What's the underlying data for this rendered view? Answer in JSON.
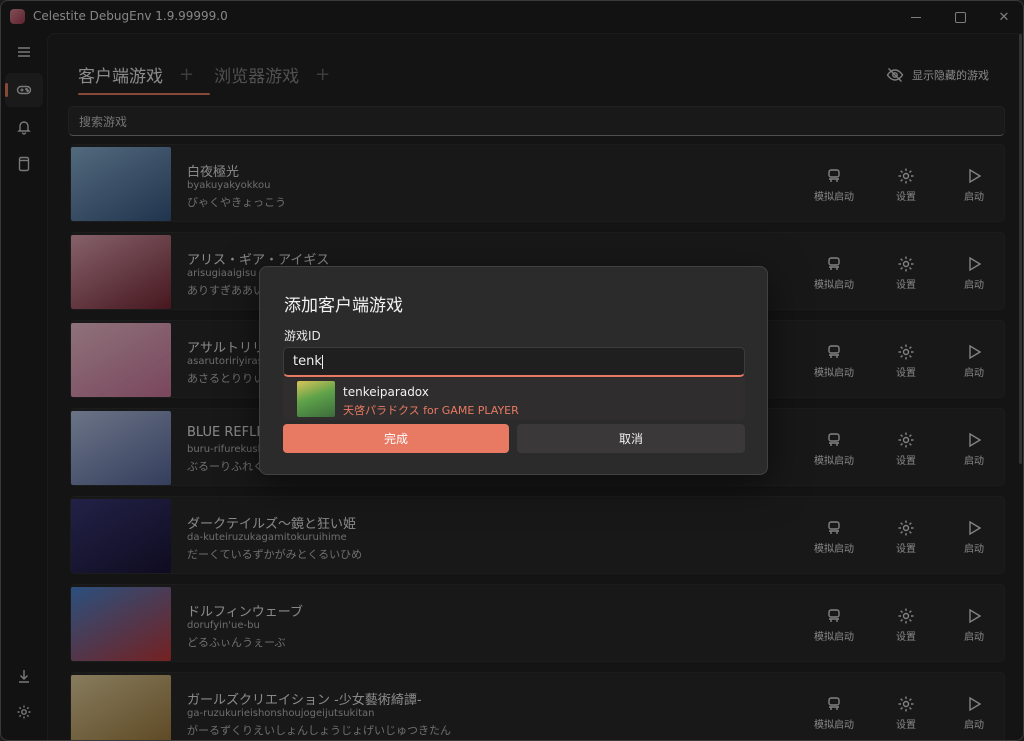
{
  "window": {
    "title": "Celestite DebugEnv 1.9.99999.0"
  },
  "tabs": [
    {
      "label": "客户端游戏",
      "plus": "+"
    },
    {
      "label": "浏览器游戏",
      "plus": "+"
    }
  ],
  "show_hidden": "显示隐藏的游戏",
  "search": {
    "placeholder": "搜索游戏"
  },
  "actions": {
    "simulate": "模拟启动",
    "settings": "设置",
    "launch": "启动"
  },
  "games": [
    {
      "title": "白夜極光",
      "romaji": "byakuyakyokkou",
      "kana": "びゃくやきょっこう",
      "cover_colors": [
        "#8fb6d8",
        "#3a5a86"
      ]
    },
    {
      "title": "アリス・ギア・アイギス",
      "romaji": "arisugiaaigisu",
      "kana": "ありすぎああいぎす",
      "cover_colors": [
        "#e7a8b8",
        "#7a2836"
      ]
    },
    {
      "title": "アサルトリリィ",
      "romaji": "asarutoririyirasuto",
      "kana": "あさるとりりぃらすと",
      "cover_colors": [
        "#f5c4d3",
        "#d27aa0"
      ]
    },
    {
      "title": "BLUE REFLECTION SUN",
      "romaji": "buru-rifurekushonsan",
      "kana": "ぶるーりふれくしょんさん",
      "cover_colors": [
        "#b9c7e8",
        "#5a6ca0"
      ]
    },
    {
      "title": "ダークテイルズ～鏡と狂い姫",
      "romaji": "da-kuteiruzukagamitokuruihime",
      "kana": "だーくているずかがみとくるいひめ",
      "cover_colors": [
        "#3c3a7a",
        "#1a1538"
      ]
    },
    {
      "title": "ドルフィンウェーブ",
      "romaji": "dorufyin'ue-bu",
      "kana": "どるふぃんうぇーぶ",
      "cover_colors": [
        "#4a8ad8",
        "#c83a3a"
      ]
    },
    {
      "title": "ガールズクリエイション -少女藝術綺譚-",
      "romaji": "ga-ruzukurieishonshoujogeijutsukitan",
      "kana": "がーるずくりえいしょんしょうじょげいじゅつきたん",
      "cover_colors": [
        "#e8d6a2",
        "#a07a3a"
      ]
    }
  ],
  "dialog": {
    "title": "添加客户端游戏",
    "field_label": "游戏ID",
    "input_value": "tenk",
    "suggestion": {
      "id": "tenkeiparadox",
      "name": "天啓パラドクス for GAME PLAYER"
    },
    "confirm": "完成",
    "cancel": "取消"
  },
  "colors": {
    "accent": "#e87a63",
    "background": "#1f1f1f",
    "panel": "#252323"
  }
}
